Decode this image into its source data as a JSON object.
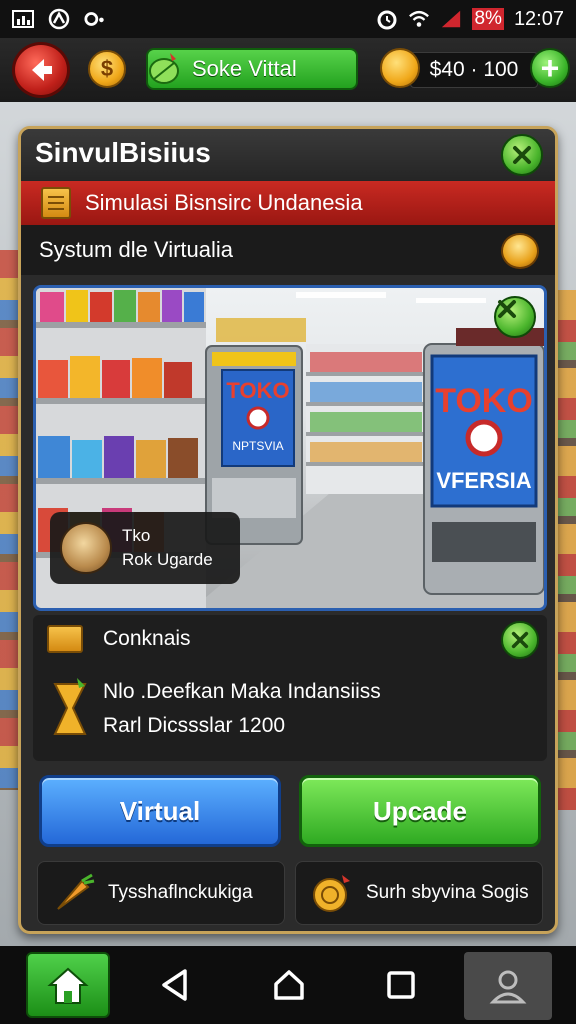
{
  "status_bar": {
    "battery_text": "8%",
    "time": "12:07"
  },
  "hud": {
    "coin_symbol": "$",
    "mode_label": "Soke Vittal",
    "money": "$40 · 100",
    "plus_symbol": "+"
  },
  "panel": {
    "title": "SinvulBisiius",
    "banner": "Simulasi Bisnsirc Undanesia",
    "subtitle": "Systum dle Virtualia"
  },
  "scene": {
    "kiosk_center": [
      "TOKO",
      "NPTSVIA"
    ],
    "kiosk_right": [
      "TOKO",
      "VFERSIA"
    ],
    "tooltip": {
      "line1": "Tko",
      "line2": "Rok Ugarde"
    }
  },
  "info": {
    "header": "Conknais",
    "line1": "Nlo .Deefkan Maka Indansiiss",
    "line2": "Rarl Dicssslar 1200"
  },
  "buttons": {
    "virtual": "Virtual",
    "upgrade": "Upcade"
  },
  "secondary": {
    "left": "Tysshaflnckukiga",
    "right": "Surh sbyvina Sogis"
  },
  "colors": {
    "accent_red": "#c92a22",
    "accent_green": "#2faa22",
    "accent_blue": "#2468d8",
    "panel_border": "#c7a35a"
  }
}
